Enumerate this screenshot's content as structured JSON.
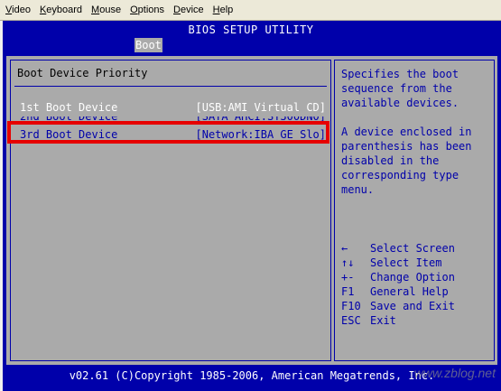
{
  "menubar": {
    "items": [
      "Video",
      "Keyboard",
      "Mouse",
      "Options",
      "Device",
      "Help"
    ]
  },
  "bios": {
    "title": "BIOS SETUP UTILITY",
    "active_tab": "Boot",
    "section_title": "Boot Device Priority",
    "devices": [
      {
        "label": "1st Boot Device",
        "value": "[USB:AMI Virtual CD]"
      },
      {
        "label": "2nd Boot Device",
        "value": "[SATA AHCI:ST300DN0]"
      },
      {
        "label": "3rd Boot Device",
        "value": "[Network:IBA GE Slo]"
      }
    ],
    "help": [
      "Specifies the boot sequence from the available devices.",
      "A device enclosed in parenthesis has been disabled in the corresponding type menu."
    ],
    "keys": [
      {
        "key": "←",
        "desc": "Select Screen"
      },
      {
        "key": "↑↓",
        "desc": "Select Item"
      },
      {
        "key": "+-",
        "desc": "Change Option"
      },
      {
        "key": "F1",
        "desc": "General Help"
      },
      {
        "key": "F10",
        "desc": "Save and Exit"
      },
      {
        "key": "ESC",
        "desc": "Exit"
      }
    ],
    "footer": "v02.61 (C)Copyright 1985-2006, American Megatrends, Inc."
  },
  "watermark": "www.zblog.net",
  "colors": {
    "bios_blue": "#0000aa",
    "panel_grey": "#aaaaaa",
    "highlight_red": "#e60000"
  }
}
